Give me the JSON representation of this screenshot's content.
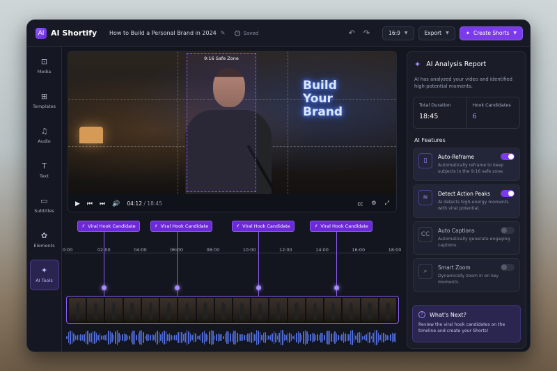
{
  "app": {
    "name": "AI Shortify",
    "logo_glyph": "AI"
  },
  "header": {
    "project_title": "How to Build a Personal Brand in 2024",
    "saved_label": "Saved",
    "aspect_ratio": "16:9",
    "export_label": "Export",
    "create_label": "Create Shorts",
    "accent": "#7c3aed"
  },
  "sidebar": {
    "items": [
      {
        "label": "Media",
        "icon": "media-icon",
        "glyph": "⊡"
      },
      {
        "label": "Templates",
        "icon": "templates-icon",
        "glyph": "⊞"
      },
      {
        "label": "Audio",
        "icon": "music-icon",
        "glyph": "♫"
      },
      {
        "label": "Text",
        "icon": "text-icon",
        "glyph": "T"
      },
      {
        "label": "Subtitles",
        "icon": "subtitles-icon",
        "glyph": "▭"
      },
      {
        "label": "Elements",
        "icon": "elements-icon",
        "glyph": "✿"
      },
      {
        "label": "AI Tools",
        "icon": "magic-wand-icon",
        "glyph": "✦",
        "active": true
      }
    ]
  },
  "player": {
    "safe_zone_label": "9:16 Safe Zone",
    "neon_text": "Build\nYour\nBrand",
    "current_time": "04:12",
    "separator": "/",
    "total_time": "18:45",
    "progress": 0.22
  },
  "timeline": {
    "hook_label": "Viral Hook Candidate",
    "hooks": [
      {
        "time_min": 2.0
      },
      {
        "time_min": 6.0
      },
      {
        "time_min": 10.5
      },
      {
        "time_min": 14.8
      }
    ],
    "ticks": [
      "0:00",
      "02:00",
      "04:00",
      "06:00",
      "08:00",
      "10:00",
      "12:00",
      "14:00",
      "16:00",
      "18:00"
    ],
    "span_min": 18
  },
  "analysis": {
    "title": "AI Analysis Report",
    "description": "AI has analyzed your video and identified high-potential moments.",
    "total_duration_label": "Total Duration",
    "total_duration": "18:45",
    "hook_candidates_label": "Hook Candidates",
    "hook_candidates": "6",
    "features_title": "AI Features",
    "features": [
      {
        "title": "Auto-Reframe",
        "desc": "Automatically reframe to keep subjects in the 9:16 safe zone.",
        "on": true,
        "icon": "reframe-icon",
        "glyph": "▯"
      },
      {
        "title": "Detect Action Peaks",
        "desc": "AI detects high-energy moments with viral potential.",
        "on": true,
        "icon": "waveform-icon",
        "glyph": "≋"
      },
      {
        "title": "Auto Captions",
        "desc": "Automatically generate engaging captions.",
        "on": false,
        "icon": "captions-icon",
        "glyph": "CC"
      },
      {
        "title": "Smart Zoom",
        "desc": "Dynamically zoom in on key moments.",
        "on": false,
        "icon": "zoom-icon",
        "glyph": "⌕"
      }
    ],
    "next_title": "What's Next?",
    "next_desc": "Review the viral hook candidates on the timeline and create your Shorts!"
  }
}
